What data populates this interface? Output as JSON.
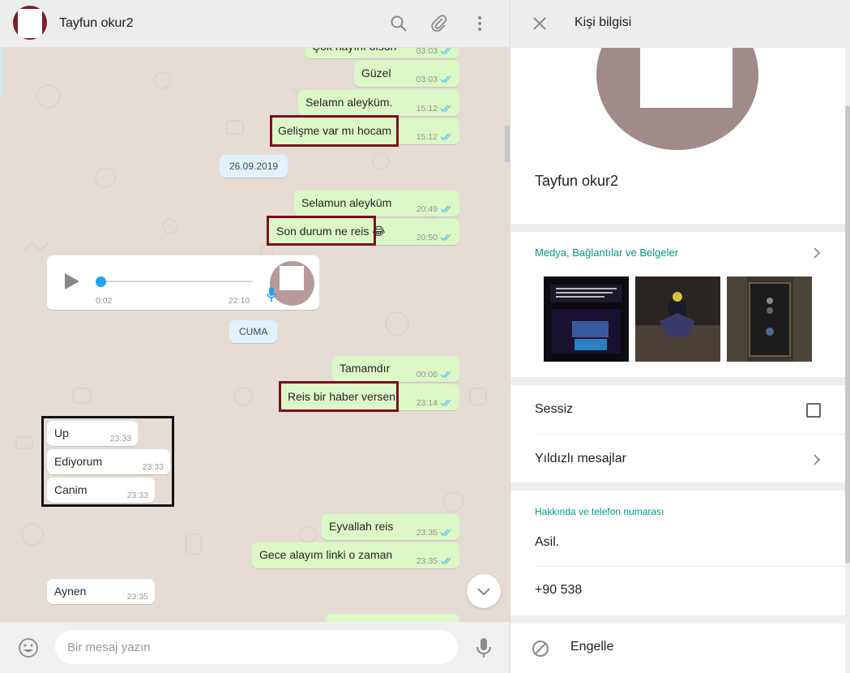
{
  "chat": {
    "contact_name": "Tayfun okur2",
    "messages": [
      {
        "text": "Çok hayırlı olsun",
        "time": "03:03",
        "dir": "out"
      },
      {
        "text": "Güzel",
        "time": "03:03",
        "dir": "out"
      },
      {
        "text": "Selamn aleyküm.",
        "time": "15:12",
        "dir": "out"
      },
      {
        "text": "Gelişme var mı hocam",
        "time": "15:12",
        "dir": "out"
      },
      {
        "text": "Selamun aleyküm",
        "time": "20:49",
        "dir": "out"
      },
      {
        "text": "Son durum ne reis 😂",
        "time": "20:50",
        "dir": "out"
      },
      {
        "text": "Tamamdır",
        "time": "00:06",
        "dir": "out"
      },
      {
        "text": "Reis bir haber versen",
        "time": "23:14",
        "dir": "out"
      },
      {
        "text": "Up",
        "time": "23:33",
        "dir": "in"
      },
      {
        "text": "Ediyorum",
        "time": "23:33",
        "dir": "in"
      },
      {
        "text": "Canim",
        "time": "23:33",
        "dir": "in"
      },
      {
        "text": "Eyvallah reis",
        "time": "23:35",
        "dir": "out"
      },
      {
        "text": "Gece alayım linki o zaman",
        "time": "23:35",
        "dir": "out"
      },
      {
        "text": "Aynen",
        "time": "23:35",
        "dir": "in"
      }
    ],
    "date_chips": [
      "26.09.2019",
      "CUMA"
    ],
    "voice": {
      "duration": "0:02",
      "time": "22:10"
    },
    "composer_placeholder": "Bir mesaj yazın",
    "colors": {
      "outgoing": "#dcf8c6",
      "incoming": "#ffffff",
      "tick": "#4fc3f7",
      "highlight": "#7b1020"
    }
  },
  "info": {
    "title": "Kişi bilgisi",
    "contact_name": "Tayfun okur2",
    "media_title": "Medya, Bağlantılar ve Belgeler",
    "mute_label": "Sessiz",
    "starred_label": "Yıldızlı mesajlar",
    "about_title": "Hakkında ve telefon numarası",
    "about_text": "Asil.",
    "phone": "+90 538",
    "block_label": "Engelle",
    "accent": "#009688"
  },
  "icons": [
    "search-icon",
    "paperclip-icon",
    "menu-icon",
    "close-icon",
    "chevron-right-icon",
    "chevron-down-icon",
    "emoji-icon",
    "mic-icon",
    "block-icon",
    "play-icon"
  ]
}
